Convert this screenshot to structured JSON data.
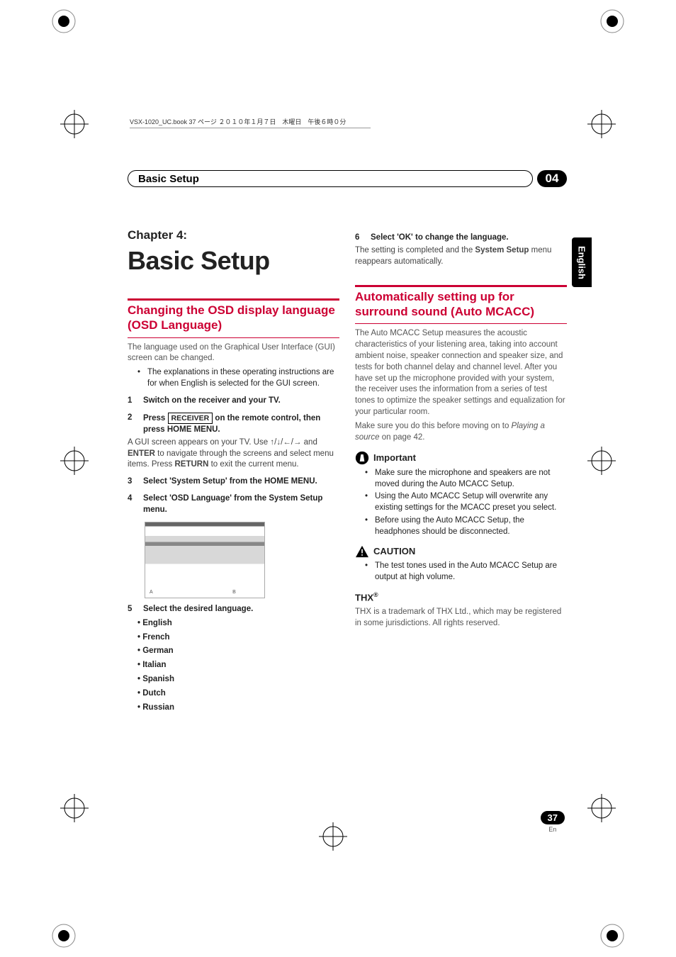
{
  "book_header": "VSX-1020_UC.book  37 ページ  ２０１０年１月７日　木曜日　午後６時０分",
  "lang_tab": "English",
  "header": {
    "title": "Basic Setup",
    "num": "04"
  },
  "chapter": {
    "label": "Chapter 4:",
    "title": "Basic Setup"
  },
  "left": {
    "h2": "Changing the OSD display language (OSD Language)",
    "intro": "The language used on the Graphical User Interface (GUI) screen can be changed.",
    "note_bullet": "The explanations in these operating instructions are for when English is selected for the GUI screen.",
    "step1": {
      "n": "1",
      "t": "Switch on the receiver and your TV."
    },
    "step2": {
      "n": "2",
      "t_pre": "Press ",
      "btn": "RECEIVER",
      "t_post": " on the remote control, then press HOME MENU."
    },
    "step2_body_1": "A GUI screen appears on your TV. Use ",
    "step2_body_2": " and ",
    "step2_body_enter": "ENTER",
    "step2_body_3": " to navigate through the screens and select menu items. Press ",
    "step2_body_return": "RETURN",
    "step2_body_4": " to exit the current menu.",
    "step3": {
      "n": "3",
      "t": "Select 'System Setup' from the HOME MENU."
    },
    "step4": {
      "n": "4",
      "t": "Select 'OSD Language' from the System Setup menu."
    },
    "step5": {
      "n": "5",
      "t": "Select the desired language."
    },
    "langs": [
      "English",
      "French",
      "German",
      "Italian",
      "Spanish",
      "Dutch",
      "Russian"
    ]
  },
  "right": {
    "step6": {
      "n": "6",
      "t": "Select 'OK' to change the language."
    },
    "step6_body_1": "The setting is completed and the ",
    "step6_body_bold": "System Setup",
    "step6_body_2": " menu reappears automatically.",
    "h2": "Automatically setting up for surround sound (Auto MCACC)",
    "para1": "The Auto MCACC Setup measures the acoustic characteristics of your listening area, taking into account ambient noise, speaker connection and speaker size, and tests for both channel delay and channel level. After you have set up the microphone provided with your system, the receiver uses the information from a series of test tones to optimize the speaker settings and equalization for your particular room.",
    "para2_1": "Make sure you do this before moving on to ",
    "para2_ital": "Playing a source",
    "para2_2": " on page 42.",
    "important_label": "Important",
    "imp1": "Make sure the microphone and speakers are not moved during the Auto MCACC Setup.",
    "imp2": "Using the Auto MCACC Setup will overwrite any existing settings for the MCACC preset you select.",
    "imp3": "Before using the Auto MCACC Setup, the headphones should be disconnected.",
    "caution_label": "CAUTION",
    "caution1": "The test tones used in the Auto MCACC Setup are output at high volume.",
    "thx_label": "THX",
    "thx_body": "THX is a trademark of THX Ltd., which may be registered in some jurisdictions. All rights reserved."
  },
  "page_num": {
    "num": "37",
    "lang": "En"
  }
}
